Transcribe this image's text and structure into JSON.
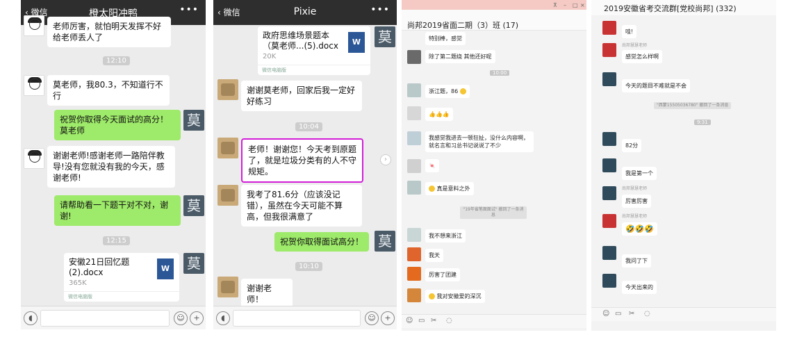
{
  "panel1": {
    "title": "橙太阳冲鸭",
    "back_label": "微信",
    "msg_top": "老师厉害，就怕明天发挥不好给老师丢人了",
    "time1": "12:10",
    "msg_score": "莫老师，我80.3，不知道行不行",
    "msg_congrats": "祝贺你取得今天面试的高分！莫老师",
    "msg_thanks": "谢谢老师!感谢老师一路陪伴教导!没有您就没有我的今天，感谢老师!",
    "msg_check": "请帮助看一下题干对不对，谢谢!",
    "time2": "12:15",
    "file_name": "安徽21日回忆题(2).docx",
    "file_size": "365K",
    "file_source": "微信电脑版",
    "avatar_mo": "莫",
    "file_icon": "W"
  },
  "panel2": {
    "title": "Pixie",
    "back_label": "微信",
    "file_name": "政府思维场景题本（莫老师...(5).docx",
    "file_size": "20K",
    "file_source": "微信电脑版",
    "msg_review": "谢谢莫老师，回家后我一定好好练习",
    "time1": "10:04",
    "msg_hl": "老师！谢谢您！今天考到原题了，就是垃圾分类有的人不守规矩。",
    "msg_816": "我考了81.6分（应该没记错），虽然在今天可能不算高，但我很满意了",
    "msg_congrats": "祝贺你取得面试高分！",
    "time2": "10:10",
    "msg_last": "谢谢老师！",
    "avatar_mo": "莫",
    "file_icon": "W"
  },
  "panel3": {
    "title": "尚邦2019省面二期（3）班 (17)",
    "m1": "特别棒，感觉",
    "m2": "除了第二题绕 其他还好呢",
    "t1": "10:00",
    "m3": "浙江题，86",
    "m4": "👍👍👍",
    "m5": "我感觉我进去一顿狂扯，没什么内容啊，就名言和习总书记说说了不少",
    "m6": "🍬",
    "m7": "真是意料之外",
    "sys1": "\"19年省笔面面试\" 撤回了一条消息",
    "m8": "我不想来浙江",
    "m9": "我天",
    "m10": "厉害了团建",
    "m11": "我对安徽爱的深沉"
  },
  "panel4": {
    "title": "2019安徽省考交流群[党校尚邦] (332)",
    "f1": "哇!",
    "n1": "尚邦慧慧老师",
    "f2": "感觉怎么样啊",
    "f3": "今天的题目不难就是不会",
    "sys1": "\"西蒙15505036780\" 撤回了一条消息",
    "t1": "9:31",
    "f4": "82分",
    "f5": "我是第一个",
    "n2": "尚邦慧慧老师",
    "f6": "厉害厉害",
    "n3": "尚邦慧慧老师",
    "f7": "🤣🤣🤣",
    "f8": "我问了下",
    "f9": "今天出来的"
  },
  "colors": {
    "wx_header": "#2e2e2e",
    "wx_bg": "#ececec",
    "wx_green_bubble": "#9eea6a",
    "highlight_border": "#d21ed7",
    "word_icon": "#2b5797",
    "qq_bg": "#f3f3f3"
  }
}
